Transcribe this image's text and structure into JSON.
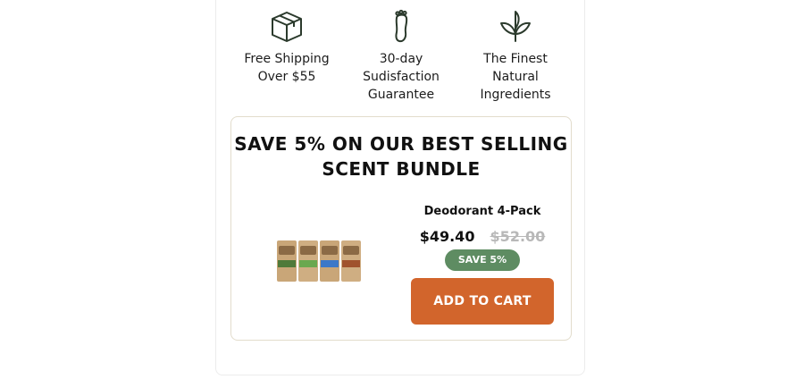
{
  "features": [
    {
      "icon": "box-icon",
      "label": "Free Shipping\nOver $55"
    },
    {
      "icon": "footprint-icon",
      "label": "30-day\nSudisfaction\nGuarantee"
    },
    {
      "icon": "leaf-icon",
      "label": "The Finest\nNatural\nIngredients"
    }
  ],
  "bundle": {
    "title": "SAVE 5% ON OUR BEST SELLING SCENT BUNDLE",
    "product_name": "Deodorant 4-Pack",
    "price_now": "$49.40",
    "price_was": "$52.00",
    "save_badge": "SAVE 5%",
    "add_to_cart_label": "ADD TO CART"
  },
  "colors": {
    "icon_stroke": "#2b3a2c",
    "badge_green": "#5e8c62",
    "button_orange": "#d2652c",
    "bundle_border": "#e2dccc"
  }
}
